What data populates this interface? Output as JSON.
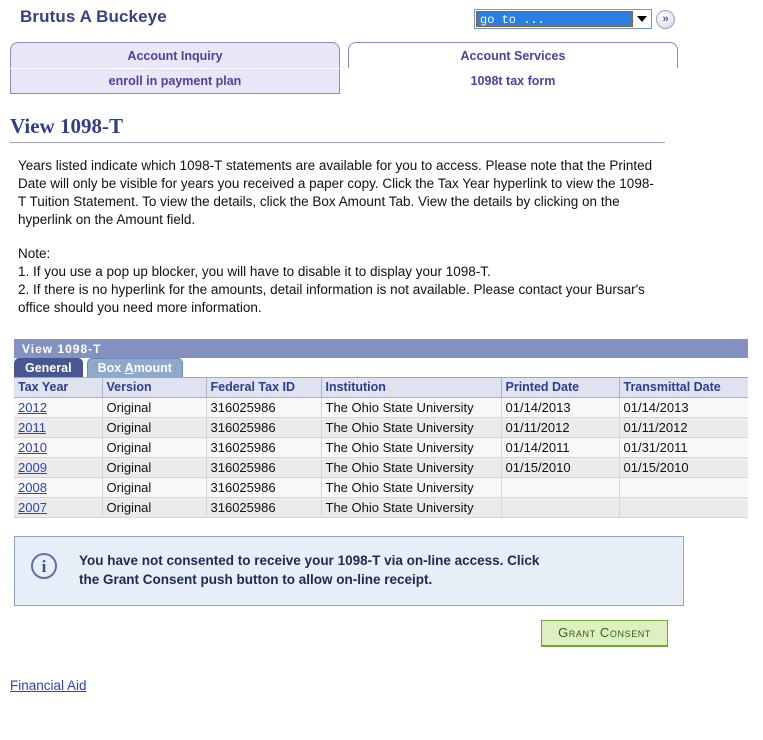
{
  "header": {
    "user_name": "Brutus A Buckeye",
    "goto": {
      "value": "go to ...",
      "go_label": "»"
    }
  },
  "tabs": {
    "level1": [
      {
        "label": "Account Inquiry",
        "active": false
      },
      {
        "label": "Account Services",
        "active": true
      }
    ],
    "level2": [
      {
        "label": "enroll in payment plan",
        "active": false
      },
      {
        "label": "1098t tax form",
        "active": true
      }
    ]
  },
  "page": {
    "title": "View 1098-T",
    "intro": "Years listed indicate which 1098-T statements are available for you to access.  Please note that the Printed Date will only be visible for years you received a paper copy.  Click the Tax Year hyperlink to view the 1098-T Tuition Statement.  To view the details, click the Box Amount Tab.  View the details by clicking on the hyperlink on the Amount field.",
    "note_heading": "Note:",
    "note_1": "1.  If you use a pop up blocker, you will have to disable it to display your 1098-T.",
    "note_2": "2.  If there is no hyperlink for the amounts, detail information is not available.  Please contact your Bursar's office should you need more information."
  },
  "grid": {
    "title": "View 1098-T",
    "subtabs": [
      {
        "label": "General",
        "active": true,
        "accesskey": ""
      },
      {
        "label": "Box Amount",
        "active": false,
        "accesskey": "A"
      }
    ],
    "columns": [
      "Tax Year",
      "Version",
      "Federal Tax ID",
      "Institution",
      "Printed Date",
      "Transmittal Date"
    ],
    "rows": [
      {
        "tax_year": "2012",
        "version": "Original",
        "federal_tax_id": "316025986",
        "institution": "The Ohio State University",
        "printed_date": "01/14/2013",
        "transmittal_date": "01/14/2013"
      },
      {
        "tax_year": "2011",
        "version": "Original",
        "federal_tax_id": "316025986",
        "institution": "The Ohio State University",
        "printed_date": "01/11/2012",
        "transmittal_date": "01/11/2012"
      },
      {
        "tax_year": "2010",
        "version": "Original",
        "federal_tax_id": "316025986",
        "institution": "The Ohio State University",
        "printed_date": "01/14/2011",
        "transmittal_date": "01/31/2011"
      },
      {
        "tax_year": "2009",
        "version": "Original",
        "federal_tax_id": "316025986",
        "institution": "The Ohio State University",
        "printed_date": "01/15/2010",
        "transmittal_date": "01/15/2010"
      },
      {
        "tax_year": "2008",
        "version": "Original",
        "federal_tax_id": "316025986",
        "institution": "The Ohio State University",
        "printed_date": "",
        "transmittal_date": ""
      },
      {
        "tax_year": "2007",
        "version": "Original",
        "federal_tax_id": "316025986",
        "institution": "The Ohio State University",
        "printed_date": "",
        "transmittal_date": ""
      }
    ]
  },
  "message": {
    "icon": "info-icon",
    "line1": "You have not consented to receive your 1098-T via on-line access.  Click",
    "line2": "the Grant Consent push button to allow on-line receipt."
  },
  "actions": {
    "grant_consent": "Grant Consent"
  },
  "footer": {
    "link": "Financial Aid"
  },
  "colors": {
    "tab_text": "#4d3fa3",
    "tab_inactive_bg": "#e9e7f7",
    "grid_title_bg": "#8492c2",
    "subtab_active_bg": "#4a5691",
    "subtab_inactive_bg": "#8fa8ce",
    "link": "#2b3fd0",
    "button_bg": "#dff0c0",
    "button_border": "#6aa83c",
    "message_bg": "#e8eef7"
  }
}
